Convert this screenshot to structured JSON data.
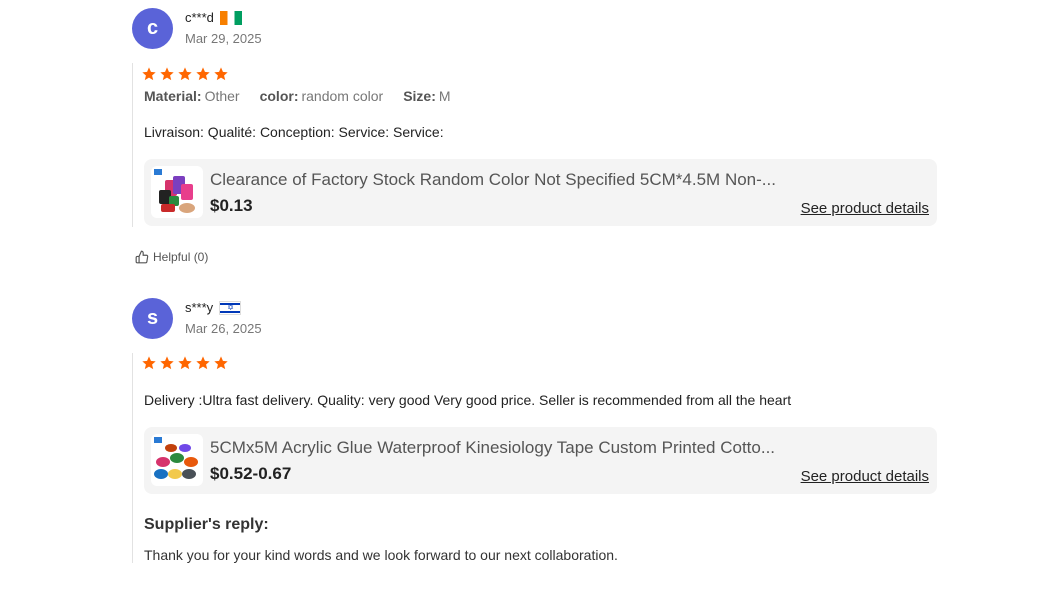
{
  "colors": {
    "avatar": "#5a63d8",
    "star": "#ff6600"
  },
  "reviews": [
    {
      "avatar_letter": "c",
      "username": "c***d",
      "flag": "CI",
      "date": "Mar 29, 2025",
      "rating": 5,
      "attributes": [
        {
          "key": "Material:",
          "value": "Other"
        },
        {
          "key": "color:",
          "value": "random color"
        },
        {
          "key": "Size:",
          "value": "M"
        }
      ],
      "text": "Livraison: Qualité: Conception: Service: Service:",
      "product": {
        "title": "Clearance of Factory Stock Random Color Not Specified 5CM*4.5M Non-...",
        "price": "$0.13",
        "link": "See product details"
      },
      "helpful": "Helpful (0)"
    },
    {
      "avatar_letter": "s",
      "username": "s***y",
      "flag": "IL",
      "date": "Mar 26, 2025",
      "rating": 5,
      "text": "Delivery :Ultra fast delivery. Quality: very good Very good price. Seller is recommended from all the heart",
      "product": {
        "title": "5CMx5M Acrylic Glue Waterproof Kinesiology Tape Custom Printed Cotto...",
        "price": "$0.52-0.67",
        "link": "See product details"
      },
      "supplier_reply": {
        "heading": "Supplier's reply:",
        "text": "Thank you for your kind words and we look forward to our next collaboration."
      }
    }
  ]
}
